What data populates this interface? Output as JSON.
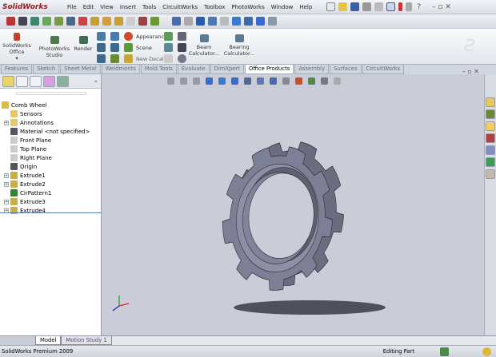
{
  "app": {
    "title": "SolidWorks"
  },
  "menu": [
    "File",
    "Edit",
    "View",
    "Insert",
    "Tools",
    "CircuitWorks",
    "Toolbox",
    "PhotoWorks",
    "Window",
    "Help"
  ],
  "command_manager": {
    "office": "SolidWorks Office",
    "photoworks_studio": "PhotoWorks Studio",
    "render": "Render",
    "appearance": "Appearance",
    "scene": "Scene",
    "new_decal": "New Decal",
    "beam": "Beam Calculator...",
    "bearing": "Bearing Calculator..."
  },
  "tabs": [
    {
      "label": "Features"
    },
    {
      "label": "Sketch"
    },
    {
      "label": "Sheet Metal"
    },
    {
      "label": "Weldments"
    },
    {
      "label": "Mold Tools"
    },
    {
      "label": "Evaluate"
    },
    {
      "label": "DimXpert"
    },
    {
      "label": "Office Products",
      "active": true
    },
    {
      "label": "Assembly"
    },
    {
      "label": "Surfaces"
    },
    {
      "label": "CircuitWorks"
    }
  ],
  "tree": {
    "root": "Comb Wheel",
    "items": [
      {
        "label": "Sensors",
        "icon": "sensor-icon",
        "expandable": false
      },
      {
        "label": "Annotations",
        "icon": "annotation-icon",
        "expandable": true
      },
      {
        "label": "Material <not specified>",
        "icon": "material-icon",
        "expandable": false
      },
      {
        "label": "Front Plane",
        "icon": "plane-icon",
        "expandable": false
      },
      {
        "label": "Top Plane",
        "icon": "plane-icon",
        "expandable": false
      },
      {
        "label": "Right Plane",
        "icon": "plane-icon",
        "expandable": false
      },
      {
        "label": "Origin",
        "icon": "origin-icon",
        "expandable": false
      },
      {
        "label": "Extrude1",
        "icon": "extrude-icon",
        "expandable": true
      },
      {
        "label": "Extrude2",
        "icon": "extrude-icon",
        "expandable": true
      },
      {
        "label": "CirPattern1",
        "icon": "pattern-icon",
        "expandable": false
      },
      {
        "label": "Extrude3",
        "icon": "extrude-icon",
        "expandable": true
      },
      {
        "label": "Extrude4",
        "icon": "extrude-icon",
        "expandable": true
      }
    ]
  },
  "bottom_tabs": [
    "Model",
    "Motion Study 1"
  ],
  "status": {
    "left": "SolidWorks Premium 2009",
    "mode": "Editing Part"
  },
  "colors": {
    "viewport": "#cacdd7",
    "part": "#7c7f95"
  }
}
